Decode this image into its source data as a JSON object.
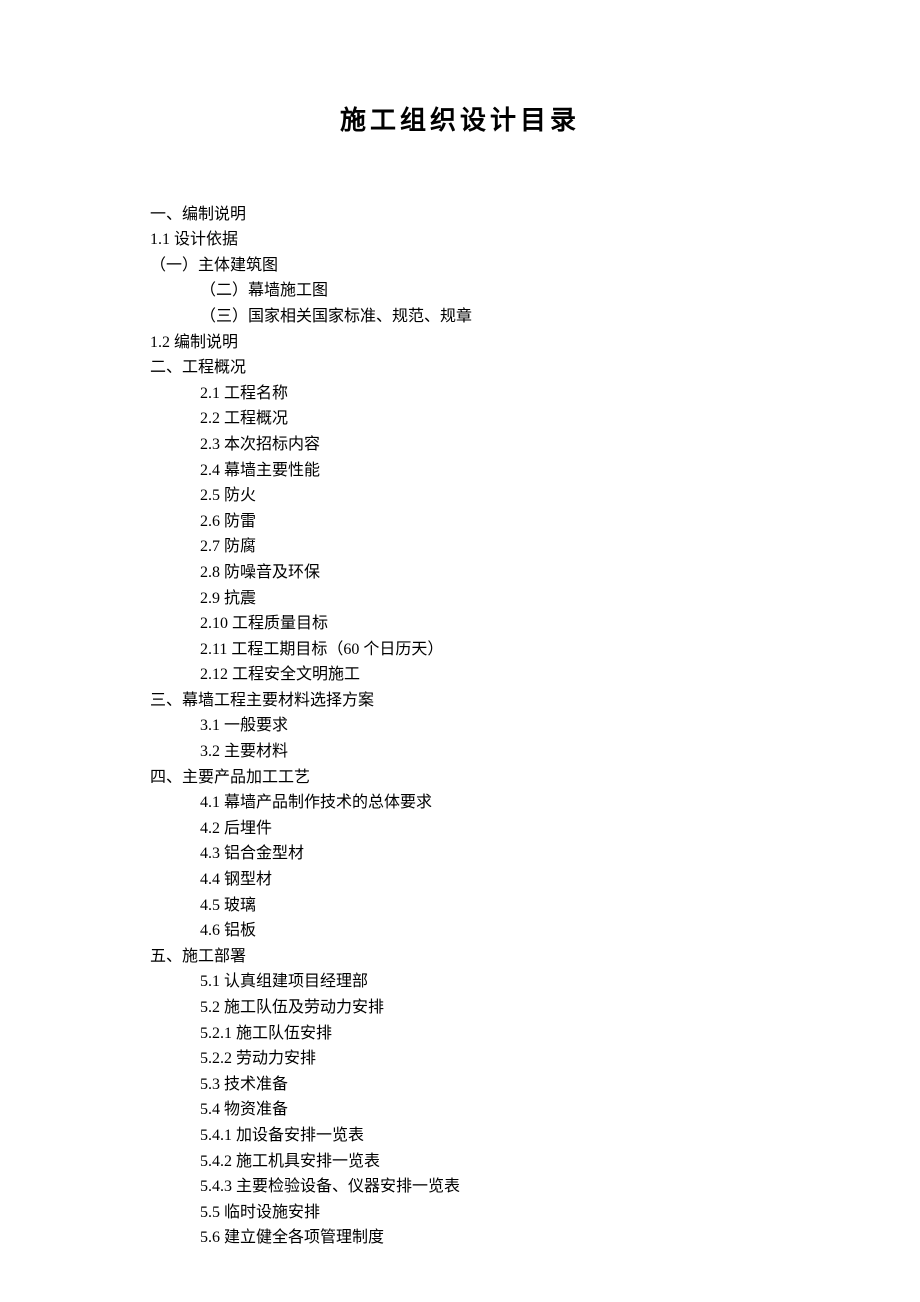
{
  "title": "施工组织设计目录",
  "lines": [
    {
      "indent": 0,
      "text": "一、编制说明"
    },
    {
      "indent": 0,
      "text": "1.1 设计依据"
    },
    {
      "indent": 0,
      "text": "（一）主体建筑图"
    },
    {
      "indent": 1,
      "text": "（二）幕墙施工图"
    },
    {
      "indent": 1,
      "text": "（三）国家相关国家标准、规范、规章"
    },
    {
      "indent": 0,
      "text": "1.2 编制说明"
    },
    {
      "indent": 0,
      "text": "二、工程概况"
    },
    {
      "indent": 1,
      "text": "2.1 工程名称"
    },
    {
      "indent": 1,
      "text": "2.2 工程概况"
    },
    {
      "indent": 1,
      "text": "2.3 本次招标内容"
    },
    {
      "indent": 1,
      "text": "2.4 幕墙主要性能"
    },
    {
      "indent": 1,
      "text": "2.5 防火"
    },
    {
      "indent": 1,
      "text": "2.6 防雷"
    },
    {
      "indent": 1,
      "text": "2.7 防腐"
    },
    {
      "indent": 1,
      "text": "2.8 防噪音及环保"
    },
    {
      "indent": 1,
      "text": "2.9 抗震"
    },
    {
      "indent": 1,
      "text": "2.10 工程质量目标"
    },
    {
      "indent": 1,
      "text": "2.11 工程工期目标（60 个日历天）"
    },
    {
      "indent": 1,
      "text": "2.12 工程安全文明施工"
    },
    {
      "indent": 0,
      "text": "三、幕墙工程主要材料选择方案"
    },
    {
      "indent": 1,
      "text": "3.1 一般要求"
    },
    {
      "indent": 1,
      "text": "3.2 主要材料"
    },
    {
      "indent": 0,
      "text": "四、主要产品加工工艺"
    },
    {
      "indent": 1,
      "text": "4.1 幕墙产品制作技术的总体要求"
    },
    {
      "indent": 1,
      "text": "4.2 后埋件"
    },
    {
      "indent": 1,
      "text": "4.3 铝合金型材"
    },
    {
      "indent": 1,
      "text": "4.4 钢型材"
    },
    {
      "indent": 1,
      "text": "4.5 玻璃"
    },
    {
      "indent": 1,
      "text": "4.6 铝板"
    },
    {
      "indent": 0,
      "text": "五、施工部署"
    },
    {
      "indent": 1,
      "text": "5.1 认真组建项目经理部"
    },
    {
      "indent": 1,
      "text": "5.2 施工队伍及劳动力安排"
    },
    {
      "indent": 1,
      "text": "5.2.1 施工队伍安排"
    },
    {
      "indent": 1,
      "text": "5.2.2 劳动力安排"
    },
    {
      "indent": 1,
      "text": "5.3 技术准备"
    },
    {
      "indent": 1,
      "text": "5.4 物资准备"
    },
    {
      "indent": 1,
      "text": "5.4.1 加设备安排一览表"
    },
    {
      "indent": 1,
      "text": "5.4.2 施工机具安排一览表"
    },
    {
      "indent": 1,
      "text": "5.4.3 主要检验设备、仪器安排一览表"
    },
    {
      "indent": 1,
      "text": "5.5 临时设施安排"
    },
    {
      "indent": 1,
      "text": "5.6 建立健全各项管理制度"
    }
  ]
}
